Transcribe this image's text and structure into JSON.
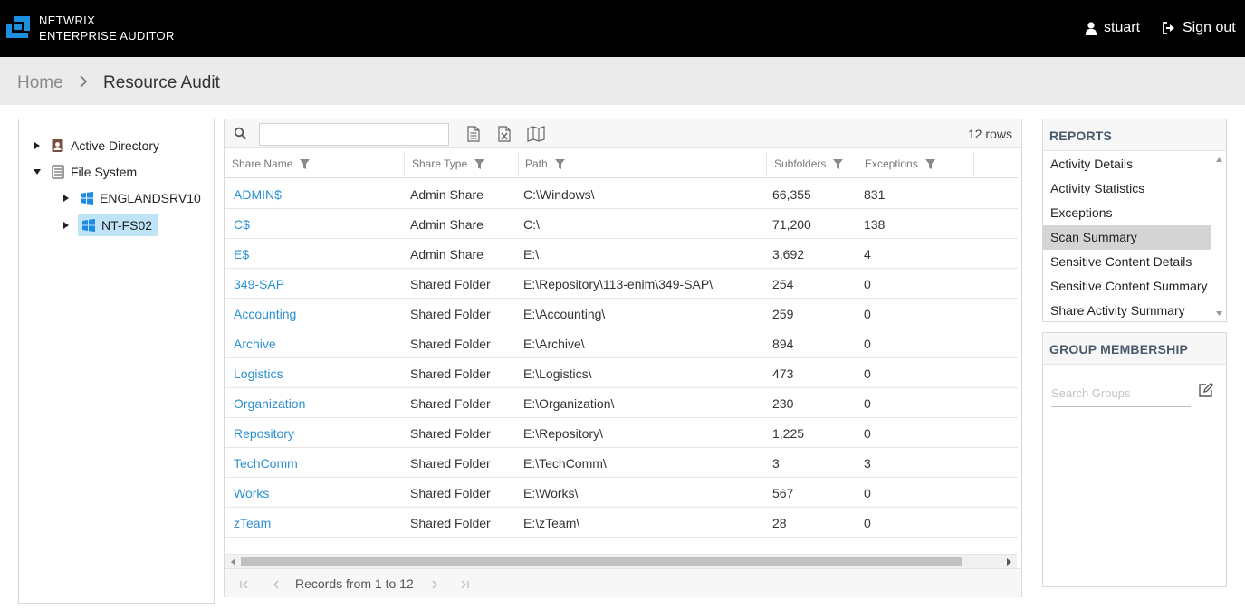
{
  "header": {
    "brand_line1": "NETWRIX",
    "brand_line2": "ENTERPRISE AUDITOR",
    "user_name": "stuart",
    "sign_out": "Sign out",
    "icons": [
      "netwrix-logo-icon",
      "user-icon",
      "sign-out-icon"
    ]
  },
  "breadcrumb": {
    "home": "Home",
    "current": "Resource Audit"
  },
  "tree": {
    "items": [
      {
        "label": "Active Directory",
        "icon": "address-book-icon",
        "expanded": false
      },
      {
        "label": "File System",
        "icon": "server-icon",
        "expanded": true
      },
      {
        "label": "ENGLANDSRV10",
        "icon": "windows-icon",
        "expanded": false
      },
      {
        "label": "NT-FS02",
        "icon": "windows-icon",
        "expanded": false,
        "selected": true
      }
    ]
  },
  "grid": {
    "search_value": "",
    "row_count": "12 rows",
    "toolbar_icons": [
      "search-icon",
      "export-document-icon",
      "export-excel-icon",
      "map-icon"
    ],
    "columns": [
      "Share Name",
      "Share Type",
      "Path",
      "Subfolders",
      "Exceptions"
    ],
    "rows": [
      [
        "ADMIN$",
        "Admin Share",
        "C:\\Windows\\",
        "66,355",
        "831"
      ],
      [
        "C$",
        "Admin Share",
        "C:\\",
        "71,200",
        "138"
      ],
      [
        "E$",
        "Admin Share",
        "E:\\",
        "3,692",
        "4"
      ],
      [
        "349-SAP",
        "Shared Folder",
        "E:\\Repository\\113-enim\\349-SAP\\",
        "254",
        "0"
      ],
      [
        "Accounting",
        "Shared Folder",
        "E:\\Accounting\\",
        "259",
        "0"
      ],
      [
        "Archive",
        "Shared Folder",
        "E:\\Archive\\",
        "894",
        "0"
      ],
      [
        "Logistics",
        "Shared Folder",
        "E:\\Logistics\\",
        "473",
        "0"
      ],
      [
        "Organization",
        "Shared Folder",
        "E:\\Organization\\",
        "230",
        "0"
      ],
      [
        "Repository",
        "Shared Folder",
        "E:\\Repository\\",
        "1,225",
        "0"
      ],
      [
        "TechComm",
        "Shared Folder",
        "E:\\TechComm\\",
        "3",
        "3"
      ],
      [
        "Works",
        "Shared Folder",
        "E:\\Works\\",
        "567",
        "0"
      ],
      [
        "zTeam",
        "Shared Folder",
        "E:\\zTeam\\",
        "28",
        "0"
      ]
    ],
    "pager_text": "Records from 1 to 12"
  },
  "reports": {
    "title": "REPORTS",
    "items": [
      "Activity Details",
      "Activity Statistics",
      "Exceptions",
      "Scan Summary",
      "Sensitive Content Details",
      "Sensitive Content Summary",
      "Share Activity Summary"
    ],
    "active": "Scan Summary"
  },
  "groups": {
    "title": "GROUP MEMBERSHIP",
    "search_placeholder": "Search Groups",
    "search_value": ""
  },
  "colors": {
    "topbar": "#000000",
    "link": "#2b8fd0",
    "selected_tree": "#bfe4f8",
    "active_report": "#d4d4d4"
  }
}
